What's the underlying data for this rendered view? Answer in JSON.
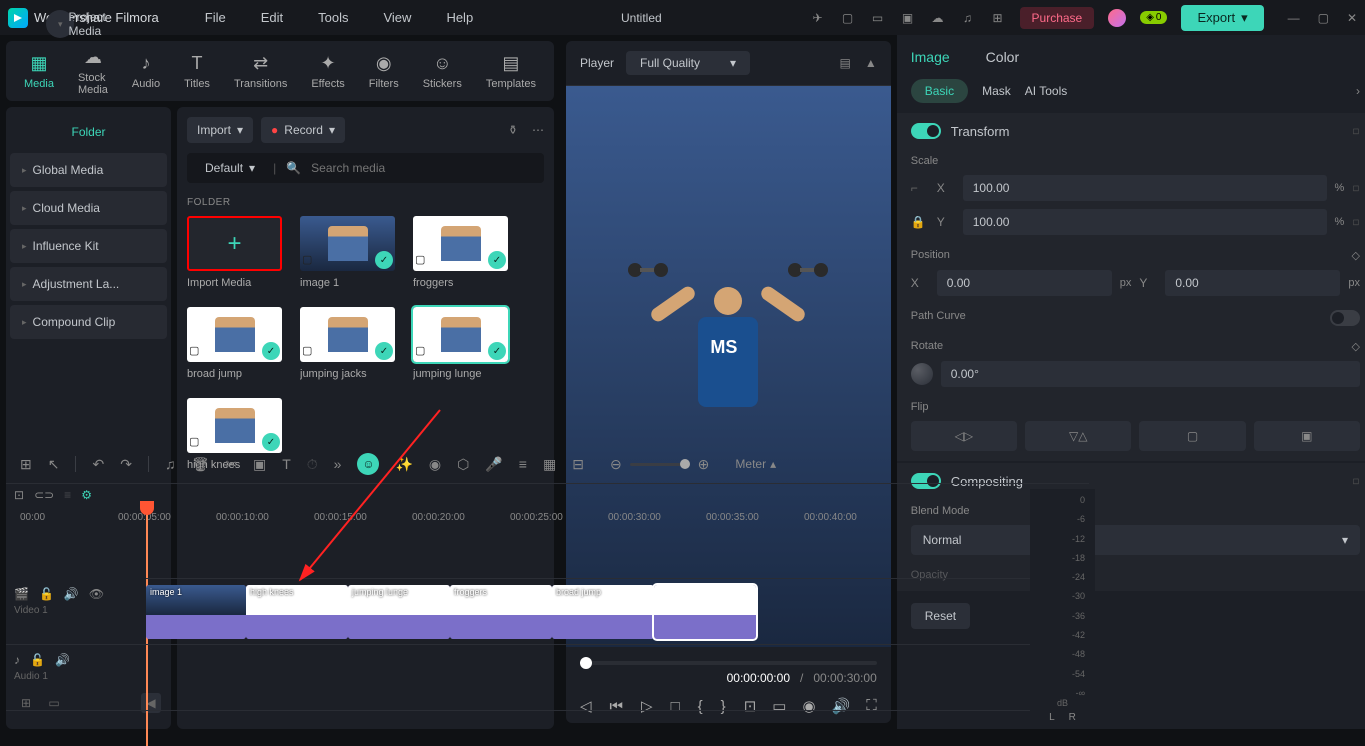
{
  "app_name": "Wondershare Filmora",
  "menu": [
    "File",
    "Edit",
    "Tools",
    "View",
    "Help"
  ],
  "doc_title": "Untitled",
  "purchase": "Purchase",
  "badge": "0",
  "export": "Export",
  "tabs": [
    "Media",
    "Stock Media",
    "Audio",
    "Titles",
    "Transitions",
    "Effects",
    "Filters",
    "Stickers",
    "Templates"
  ],
  "sidebar": {
    "head": "Project Media",
    "folder": "Folder",
    "items": [
      "Global Media",
      "Cloud Media",
      "Influence Kit",
      "Adjustment La...",
      "Compound Clip"
    ]
  },
  "mediapane": {
    "import": "Import",
    "record": "Record",
    "sort": "Default",
    "search_placeholder": "Search media",
    "folder_lbl": "FOLDER",
    "thumbs": [
      "Import Media",
      "image 1",
      "froggers",
      "broad jump",
      "jumping jacks",
      "jumping lunge",
      "high knees"
    ]
  },
  "player": {
    "label": "Player",
    "quality": "Full Quality",
    "cur": "00:00:00:00",
    "dur": "00:00:30:00"
  },
  "rpanel": {
    "tabs": [
      "Image",
      "Color"
    ],
    "subtabs": [
      "Basic",
      "Mask",
      "AI Tools"
    ],
    "transform": "Transform",
    "scale": "Scale",
    "scale_x": "100.00",
    "scale_y": "100.00",
    "position": "Position",
    "pos_x": "0.00",
    "pos_y": "0.00",
    "path_curve": "Path Curve",
    "rotate": "Rotate",
    "rotate_val": "0.00°",
    "flip": "Flip",
    "compositing": "Compositing",
    "blend_mode": "Blend Mode",
    "blend_val": "Normal",
    "opacity": "Opacity",
    "reset": "Reset"
  },
  "timeline": {
    "meter": "Meter",
    "stamps": [
      "00:00",
      "00:00:05:00",
      "00:00:10:00",
      "00:00:15:00",
      "00:00:20:00",
      "00:00:25:00",
      "00:00:30:00",
      "00:00:35:00",
      "00:00:40:00"
    ],
    "video_track": "Video 1",
    "audio_track": "Audio 1",
    "clips": [
      "image 1",
      "high knees",
      "jumping lunge",
      "froggers",
      "broad jump",
      ""
    ],
    "db": [
      "0",
      "-6",
      "-12",
      "-18",
      "-24",
      "-30",
      "-36",
      "-42",
      "-48",
      "-54",
      "-∞"
    ],
    "db_unit": "dB",
    "lr": [
      "L",
      "R"
    ]
  }
}
